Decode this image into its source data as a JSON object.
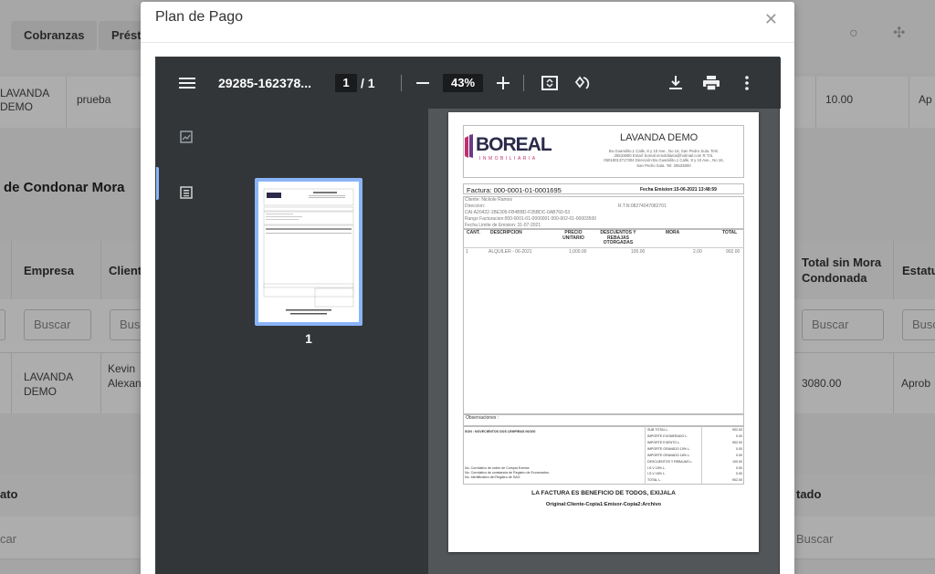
{
  "background": {
    "nav": [
      "Cobranzas",
      "Présta"
    ],
    "row1": {
      "empresa": "LAVANDA DEMO",
      "cliente": "prueba",
      "amount": "10.00",
      "status": "Ap"
    },
    "section_title": "de Condonar Mora",
    "headers": {
      "empresa": "Empresa",
      "cliente": "Client",
      "total": "Total sin Mora Condonada",
      "estatus": "Estatu"
    },
    "search_placeholder": "Buscar",
    "search_short": "Busc",
    "row2": {
      "empresa": "LAVANDA DEMO",
      "cliente": "Kevin Alexan",
      "amount": "3080.00",
      "status": "Aprob"
    },
    "section2": {
      "left": "ato",
      "right": "tado"
    },
    "search_row2": {
      "left": "car",
      "right": "Buscar"
    }
  },
  "modal": {
    "title": "Plan de Pago",
    "close_icon": "close-icon"
  },
  "viewer": {
    "filename": "29285-162378...",
    "page_current": "1",
    "page_total": "/ 1",
    "zoom": "43%",
    "thumbnail_label": "1",
    "icons": [
      "menu-icon",
      "zoom-out-icon",
      "zoom-in-icon",
      "fit-page-icon",
      "rotate-icon",
      "download-icon",
      "print-icon",
      "more-icon",
      "thumbnails-icon",
      "outline-icon"
    ]
  },
  "invoice": {
    "brand": "BOREAL",
    "brand_sub": "INMOBILIARIA",
    "company": "LAVANDA DEMO",
    "address": "Bo.Guamilito,1 Calle, 8 y 10 Ave., No 16, San Pedro Sula. Tels: 25533800 Email: boreal.inmobiliaria@hotmail.com R.T.N. 05019013717304 Dirección:Bo.Guamilito,1 Calle, 8 y 10 Ave., No 16, San Pedro Sula. Tel: 25533800",
    "factura": "Factura: 000-0001-01-0001695",
    "fecha": "Fecha Emision:15-06-2021 13:48:59",
    "cliente": "Cliente: Nickole Ramos",
    "direccion": "Direccion:",
    "rtn": "R.T.N:08274047082701",
    "cai": "CAI:A20422-1BE305-FB4BBD-F35BDC-0AB760-53",
    "rango": "Rango Facturacion:000-0001-01-0000001 000-002-01-00003500",
    "limite": "Fecha Limite de Emision: 31-07-2021",
    "columns": [
      "CANT.",
      "DESCRIPCION",
      "PRECIO UNITARIO",
      "DESCUENTOS Y REBAJAS OTORGADAS",
      "MORA",
      "TOTAL"
    ],
    "item": {
      "cant": "1",
      "desc": "ALQUILER - 06-2021",
      "precio": "1,000.00",
      "desc_reb": "100.00",
      "mora": "2.00",
      "total": "902.00"
    },
    "observaciones": "Observaciones :",
    "amount_words": "SON : NOVECIENTOS DOS LEMPIRAS 00/100",
    "totals": [
      {
        "label": "SUB TOTAL L.",
        "value": "902.00"
      },
      {
        "label": "IMPORTE EXONERADO L.",
        "value": "0.00"
      },
      {
        "label": "IMPORTE EXENTO L.",
        "value": "902.00"
      },
      {
        "label": "IMPORTE GRAVADO 15% L.",
        "value": "0.00"
      },
      {
        "label": "IMPORTE GRAVADO 18% L.",
        "value": "0.00"
      },
      {
        "label": "DESCUENTOS Y REBAJAS L.",
        "value": "100.00"
      },
      {
        "label": "I.S.V 15% L.",
        "value": "0.00"
      },
      {
        "label": "I.S.V 18% L.",
        "value": "0.00"
      },
      {
        "label": "TOTAL L.",
        "value": "902.00"
      }
    ],
    "legal": [
      "No. Correlativo de orden de Compra Exenta:",
      "No. Correlativo de constancia de Registro de Exonerados:",
      "No. Identificativo del Registro de SAG:"
    ],
    "beneficio": "LA FACTURA ES BENEFICIO DE TODOS, EXIJALA",
    "original": "Original:Cliente-Copia1:Emisor-Copia2:Archivo"
  }
}
